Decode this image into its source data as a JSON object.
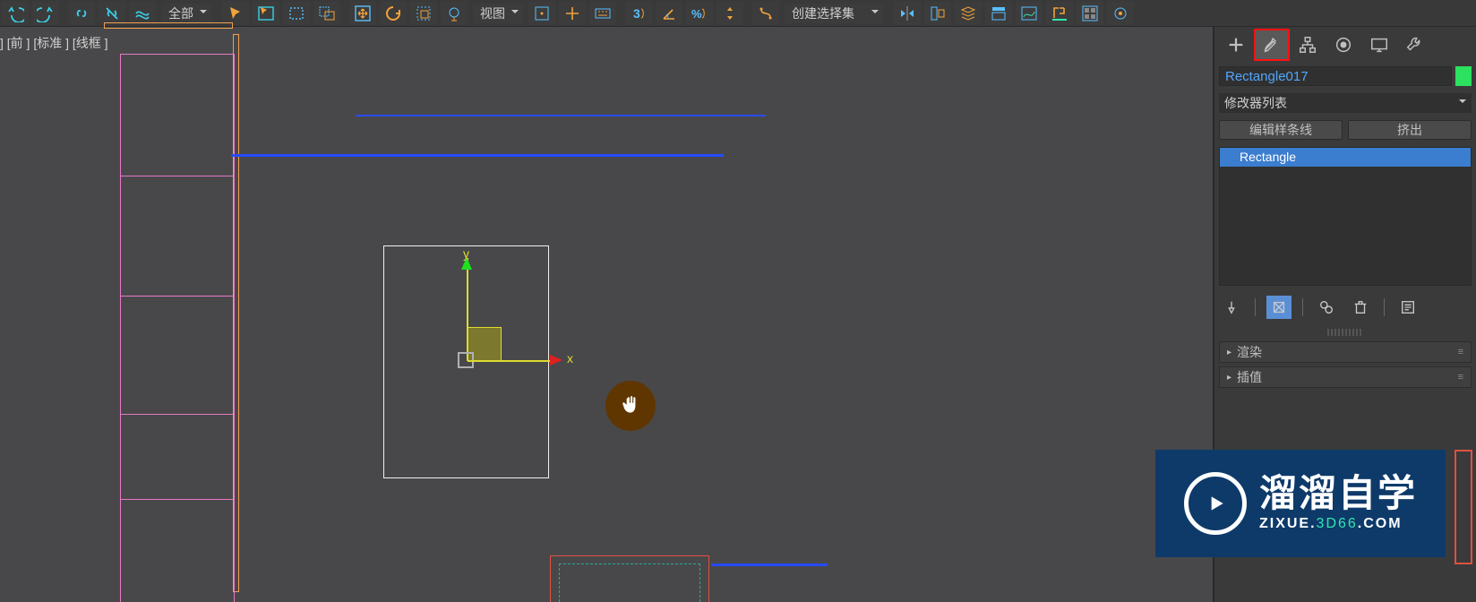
{
  "toolbar": {
    "dropdown_all": "全部",
    "dropdown_view": "视图",
    "dropdown_create_set": "创建选择集"
  },
  "viewport": {
    "label": "] [前 ] [标准 ] [线框 ]",
    "gizmo": {
      "x": "x",
      "y": "y"
    }
  },
  "panel": {
    "object_name": "Rectangle017",
    "modlist_label": "修改器列表",
    "btn_edit_spline": "编辑样条线",
    "btn_extrude": "挤出",
    "stack_item": "Rectangle",
    "rollout_render": "渲染",
    "rollout_interpolation": "插值"
  },
  "watermark": {
    "title": "溜溜自学",
    "sub_prefix": "ZIXUE.",
    "sub_highlight": "3D66",
    "sub_suffix": ".COM"
  }
}
